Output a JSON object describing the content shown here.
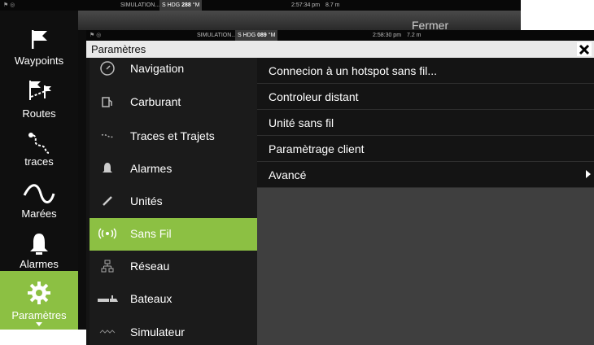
{
  "back_status": {
    "simulation": "SIMULATION...",
    "hdg_prefix": "S HDG",
    "hdg_value": "288",
    "hdg_unit": "°M",
    "time": "2:57:34 pm",
    "distance": "8.7 m"
  },
  "back_header": {
    "close_label": "Fermer"
  },
  "sidebar": {
    "items": [
      {
        "label": "Waypoints",
        "icon": "waypoint-flag-icon"
      },
      {
        "label": "Routes",
        "icon": "routes-icon"
      },
      {
        "label": "traces",
        "icon": "trails-icon"
      },
      {
        "label": "Marées",
        "icon": "tides-icon"
      },
      {
        "label": "Alarmes",
        "icon": "bell-icon"
      },
      {
        "label": "Paramètres",
        "icon": "gear-icon",
        "active": true
      }
    ]
  },
  "front_status": {
    "simulation": "SIMULATION...",
    "hdg_prefix": "S HDG",
    "hdg_value": "089",
    "hdg_unit": "°M",
    "time": "2:58:30 pm",
    "distance": "7.2 m"
  },
  "dialog": {
    "title": "Paramètres",
    "close_icon": "close-icon"
  },
  "menu": {
    "items": [
      {
        "label": "Navigation",
        "icon": "compass-icon"
      },
      {
        "label": "Carburant",
        "icon": "fuel-icon"
      },
      {
        "label": "Traces et Trajets",
        "icon": "trails-icon"
      },
      {
        "label": "Alarmes",
        "icon": "bell-icon"
      },
      {
        "label": "Unités",
        "icon": "ruler-icon"
      },
      {
        "label": "Sans Fil",
        "icon": "wireless-icon",
        "active": true
      },
      {
        "label": "Réseau",
        "icon": "network-icon"
      },
      {
        "label": "Bateaux",
        "icon": "vessels-icon"
      },
      {
        "label": "Simulateur",
        "icon": "simulator-icon"
      }
    ]
  },
  "wireless_options": {
    "items": [
      {
        "label": "Connecion à un hotspot sans fil..."
      },
      {
        "label": "Controleur distant"
      },
      {
        "label": "Unité sans fil"
      },
      {
        "label": "Paramètrage client"
      },
      {
        "label": "Avancé",
        "has_submenu": true
      }
    ]
  },
  "colors": {
    "accent": "#8cc043",
    "background": "#141414",
    "panel": "#3f3f3f"
  }
}
